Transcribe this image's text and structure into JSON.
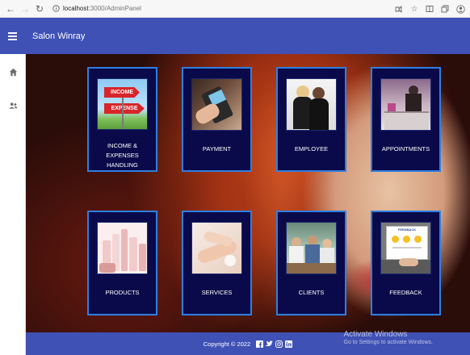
{
  "browser": {
    "url_host": "localhost",
    "url_path": ":3000/AdminPanel"
  },
  "app": {
    "title": "Salon Winray"
  },
  "sidebar": {
    "items": [
      {
        "icon": "home-icon"
      },
      {
        "icon": "users-icon"
      }
    ]
  },
  "cards": [
    {
      "label": "INCOME & EXPENSES HANDLING",
      "icon": "income-expense-image",
      "sign_top": "INCOME",
      "sign_bottom": "EXPENSE"
    },
    {
      "label": "PAYMENT",
      "icon": "payment-image"
    },
    {
      "label": "EMPLOYEE",
      "icon": "employee-image"
    },
    {
      "label": "APPOINTMENTS",
      "icon": "appointments-image"
    },
    {
      "label": "PRODUCTS",
      "icon": "products-image"
    },
    {
      "label": "SERVICES",
      "icon": "services-image"
    },
    {
      "label": "CLIENTS",
      "icon": "clients-image"
    },
    {
      "label": "FEEDBACK",
      "icon": "feedback-image",
      "form_title": "FEEDBACK"
    }
  ],
  "footer": {
    "copyright": "Copyright © 2022",
    "social": [
      "facebook-icon",
      "twitter-icon",
      "instagram-icon",
      "linkedin-icon"
    ]
  },
  "watermark": {
    "title": "Activate Windows",
    "subtitle": "Go to Settings to activate Windows."
  },
  "colors": {
    "primary": "#3f51b5",
    "card_bg": "#0a0a4a",
    "card_border": "#2f7fe0"
  }
}
